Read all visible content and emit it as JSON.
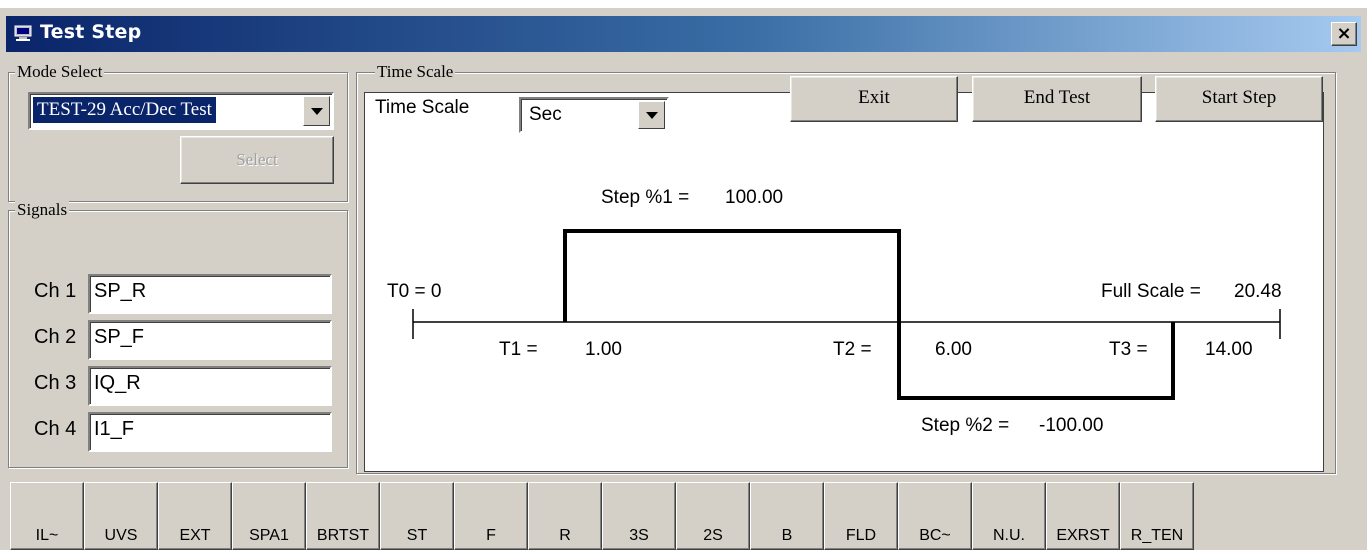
{
  "window": {
    "title": "Test Step",
    "close_glyph": "×"
  },
  "mode_select": {
    "label": "Mode Select",
    "selected": "TEST-29 Acc/Dec Test",
    "select_button": "Select"
  },
  "signals": {
    "label": "Signals",
    "channels": [
      {
        "label": "Ch 1",
        "value": "SP_R"
      },
      {
        "label": "Ch 2",
        "value": "SP_F"
      },
      {
        "label": "Ch 3",
        "value": "IQ_R"
      },
      {
        "label": "Ch 4",
        "value": "I1_F"
      }
    ]
  },
  "time_scale": {
    "group_label": "Time Scale",
    "label": "Time Scale",
    "selected": "Sec"
  },
  "actions": {
    "exit": "Exit",
    "end_test": "End Test",
    "start_step": "Start Step"
  },
  "step_graph": {
    "step1_label": "Step %1 =",
    "step1_value": "100.00",
    "step2_label": "Step %2 =",
    "step2_value": "-100.00",
    "t0_label": "T0 = 0",
    "t1_label": "T1 =",
    "t1_value": "1.00",
    "t2_label": "T2 =",
    "t2_value": "6.00",
    "t3_label": "T3 =",
    "t3_value": "14.00",
    "full_scale_label": "Full Scale =",
    "full_scale_value": "20.48"
  },
  "bottom_tabs": [
    "IL~",
    "UVS",
    "EXT",
    "SPA1",
    "BRTST",
    "ST",
    "F",
    "R",
    "3S",
    "2S",
    "B",
    "FLD",
    "BC~",
    "N.U.",
    "EXRST",
    "R_TEN"
  ],
  "colors": {
    "title_start": "#0a246a",
    "title_end": "#a6caf0",
    "face": "#d4d0c8",
    "selection": "#0a246a"
  },
  "icons": {
    "title": "computer-icon",
    "close": "close-icon",
    "dropdown": "chevron-down-icon"
  }
}
